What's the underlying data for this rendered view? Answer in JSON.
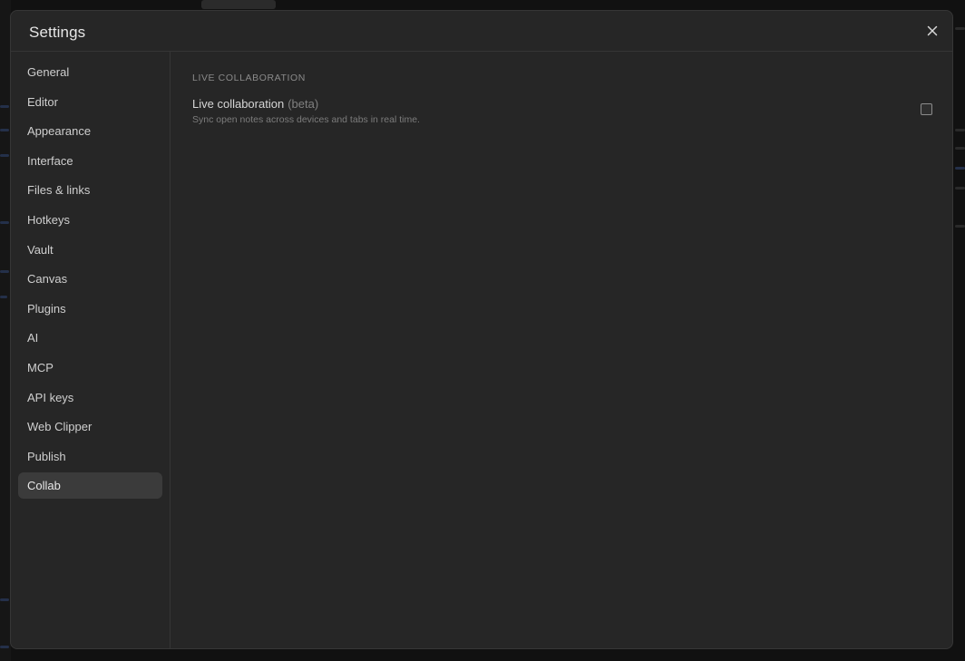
{
  "modal": {
    "title": "Settings",
    "close_icon": "close-icon"
  },
  "sidebar": {
    "items": [
      {
        "label": "General",
        "active": false
      },
      {
        "label": "Editor",
        "active": false
      },
      {
        "label": "Appearance",
        "active": false
      },
      {
        "label": "Interface",
        "active": false
      },
      {
        "label": "Files & links",
        "active": false
      },
      {
        "label": "Hotkeys",
        "active": false
      },
      {
        "label": "Vault",
        "active": false
      },
      {
        "label": "Canvas",
        "active": false
      },
      {
        "label": "Plugins",
        "active": false
      },
      {
        "label": "AI",
        "active": false
      },
      {
        "label": "MCP",
        "active": false
      },
      {
        "label": "API keys",
        "active": false
      },
      {
        "label": "Web Clipper",
        "active": false
      },
      {
        "label": "Publish",
        "active": false
      },
      {
        "label": "Collab",
        "active": true
      }
    ]
  },
  "content": {
    "section_heading": "LIVE COLLABORATION",
    "setting": {
      "name": "Live collaboration",
      "badge": "(beta)",
      "description": "Sync open notes across devices and tabs in real time.",
      "checked": false
    }
  },
  "colors": {
    "modal_bg": "#262626",
    "active_item_bg": "#3b3b3b",
    "text_primary": "#d6d6d6",
    "text_muted": "#7c7c7c"
  }
}
